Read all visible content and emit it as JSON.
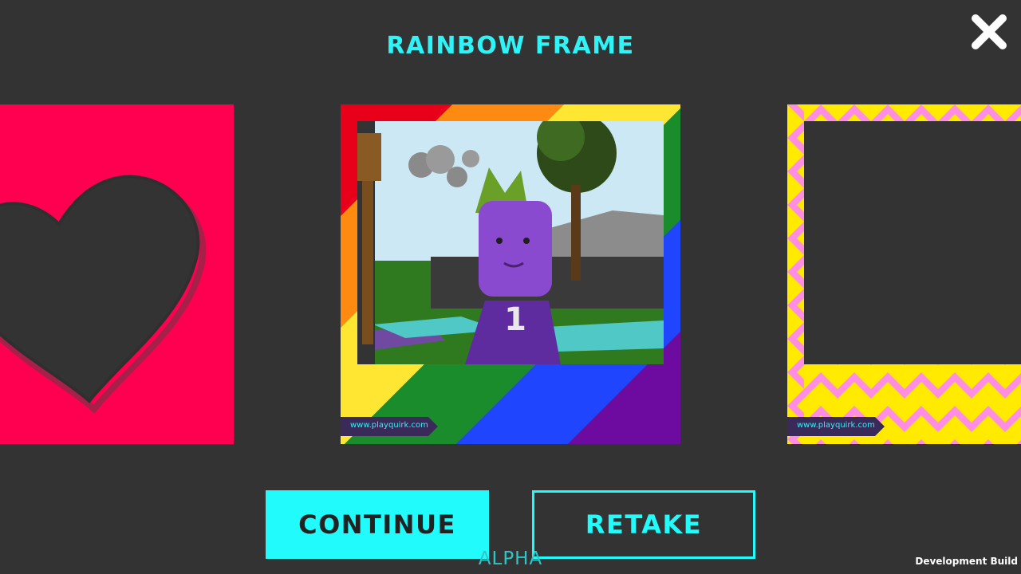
{
  "screen": {
    "title": "RAINBOW FRAME",
    "close_icon": "close-x-icon"
  },
  "frames": [
    {
      "id": "heart",
      "accent": "#ff0050",
      "pattern": "heart-outline"
    },
    {
      "id": "rainbow",
      "selected": true,
      "watermark": "www.playquirk.com",
      "stripe_colors": [
        "#e8001a",
        "#ff8a12",
        "#ffe632",
        "#1a8c2c",
        "#1f45ff",
        "#6d0aa0"
      ]
    },
    {
      "id": "zigzag",
      "colors": [
        "#ffea00",
        "#ff8de2"
      ],
      "watermark": "www.playquirk.com"
    }
  ],
  "buttons": {
    "continue_label": "CONTINUE",
    "retake_label": "RETAKE"
  },
  "footer": {
    "alpha_label": "ALPHA",
    "build_label": "Development Build"
  },
  "colors": {
    "accent": "#21fbfb",
    "background": "#333333"
  }
}
